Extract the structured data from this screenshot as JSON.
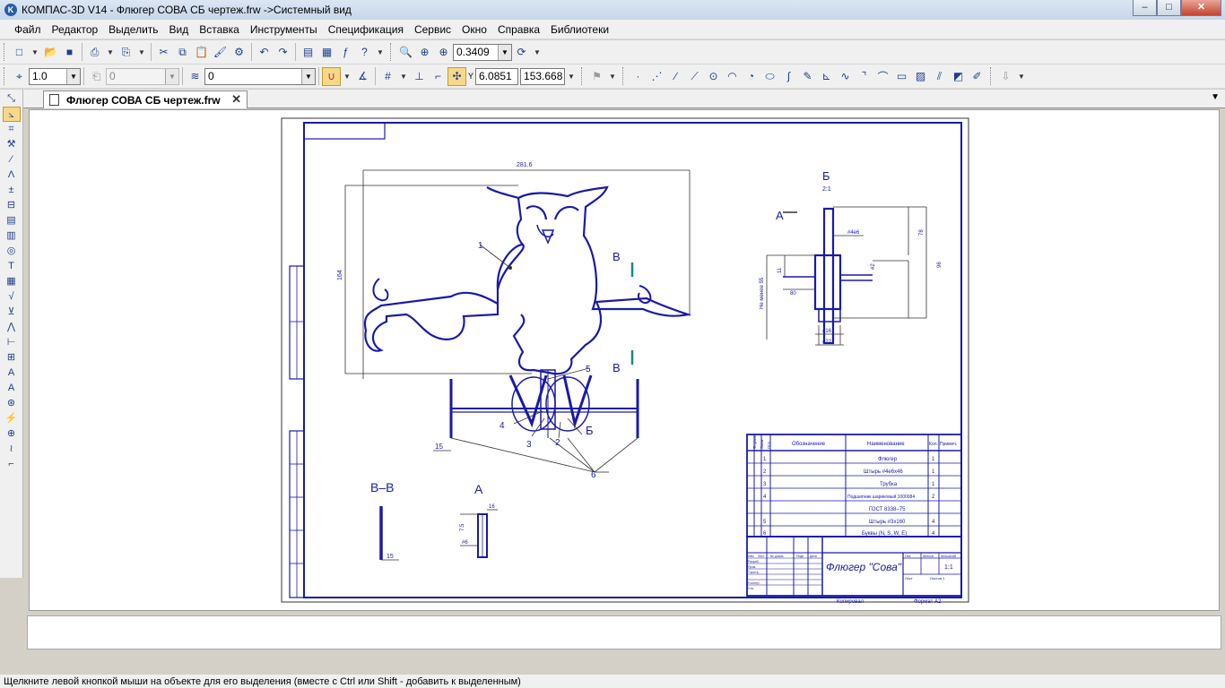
{
  "window": {
    "title": "КОМПАС-3D V14 - Флюгер СОВА СБ чертеж.frw ->Системный вид",
    "controls": {
      "minimize": "–",
      "maximize": "□",
      "close": "✕"
    }
  },
  "menu": [
    "Файл",
    "Редактор",
    "Выделить",
    "Вид",
    "Вставка",
    "Инструменты",
    "Спецификация",
    "Сервис",
    "Окно",
    "Справка",
    "Библиотеки"
  ],
  "toolbar1": {
    "zoom_value": "0.3409"
  },
  "toolbar2": {
    "line_style": "1.0",
    "layer_disabled": "0",
    "layer": "0",
    "coord_x": "6.0851",
    "coord_y": "153.668",
    "coord_y_label": "Y",
    "coord_x_label": "X"
  },
  "document": {
    "tab_title": "Флюгер СОВА СБ чертеж.frw",
    "tab_close": "✕",
    "tab_dropdown": "▼"
  },
  "drawing": {
    "dim_width": "281.6",
    "dim_height": "164",
    "leader_1": "1",
    "leader_2": "2",
    "leader_3": "3",
    "leader_4": "4",
    "leader_5": "5",
    "leader_6": "6",
    "section_V_upper": "В",
    "section_V_lower": "В",
    "section_B": "Б",
    "dim_15": "15",
    "view_B_title": "Б",
    "view_B_scale": "2:1",
    "view_B_A": "А",
    "view_B_d1": "#4e6",
    "view_B_d2": "78",
    "view_B_d3": "96",
    "view_B_d4": "11",
    "view_B_d5": "80",
    "view_B_d6": "Не менее 55",
    "view_B_d7": "#16",
    "view_B_d8": "#22",
    "view_B_d9": "#2",
    "view_VV_title": "В–В",
    "view_VV_dim": "15",
    "view_A_title": "А",
    "view_A_d1": "16",
    "view_A_d2": "7.5",
    "view_A_d3": "#6"
  },
  "spec_table": {
    "headers": [
      "Формат",
      "Зона",
      "Поз.",
      "Обозначение",
      "Наименование",
      "Кол.",
      "Примеч."
    ],
    "rows": [
      {
        "pos": "1",
        "name": "Флюгер",
        "qty": "1"
      },
      {
        "pos": "2",
        "name": "Штырь #4e6x46",
        "qty": "1"
      },
      {
        "pos": "3",
        "name": "Трубка",
        "qty": "1"
      },
      {
        "pos": "4",
        "name": "Подшипник шариковый 1000084",
        "qty": "2"
      },
      {
        "pos": "",
        "name": "ГОСТ 8338–75",
        "qty": ""
      },
      {
        "pos": "5",
        "name": "Штырь #3x160",
        "qty": "4"
      },
      {
        "pos": "6",
        "name": "Буквы (N, S, W, E)",
        "qty": "4"
      }
    ]
  },
  "title_block": {
    "name": "Флюгер \"Сова\"",
    "sheet_mass": "1:1",
    "copied": "Копировал",
    "format": "Формат А2",
    "cols": [
      "Изм",
      "Лист",
      "№ докум.",
      "Подп.",
      "Дата"
    ],
    "rows_labels": [
      "Разраб.",
      "Пров.",
      "Т.контр.",
      "Н.контр.",
      "Утв."
    ],
    "scale_labels": [
      "Лит.",
      "Масса",
      "Масштаб"
    ],
    "sheet": "Лист",
    "sheets": "Листов 1"
  },
  "status": {
    "hint": "Щелкните левой кнопкой мыши на объекте для его выделения (вместе с Ctrl или Shift - добавить к выделенным)"
  },
  "colors": {
    "drawing_line": "#1a1aa8",
    "section_marker": "#1a8a7a",
    "canvas_bg": "#ffffff",
    "chrome": "#f0f0f0"
  }
}
